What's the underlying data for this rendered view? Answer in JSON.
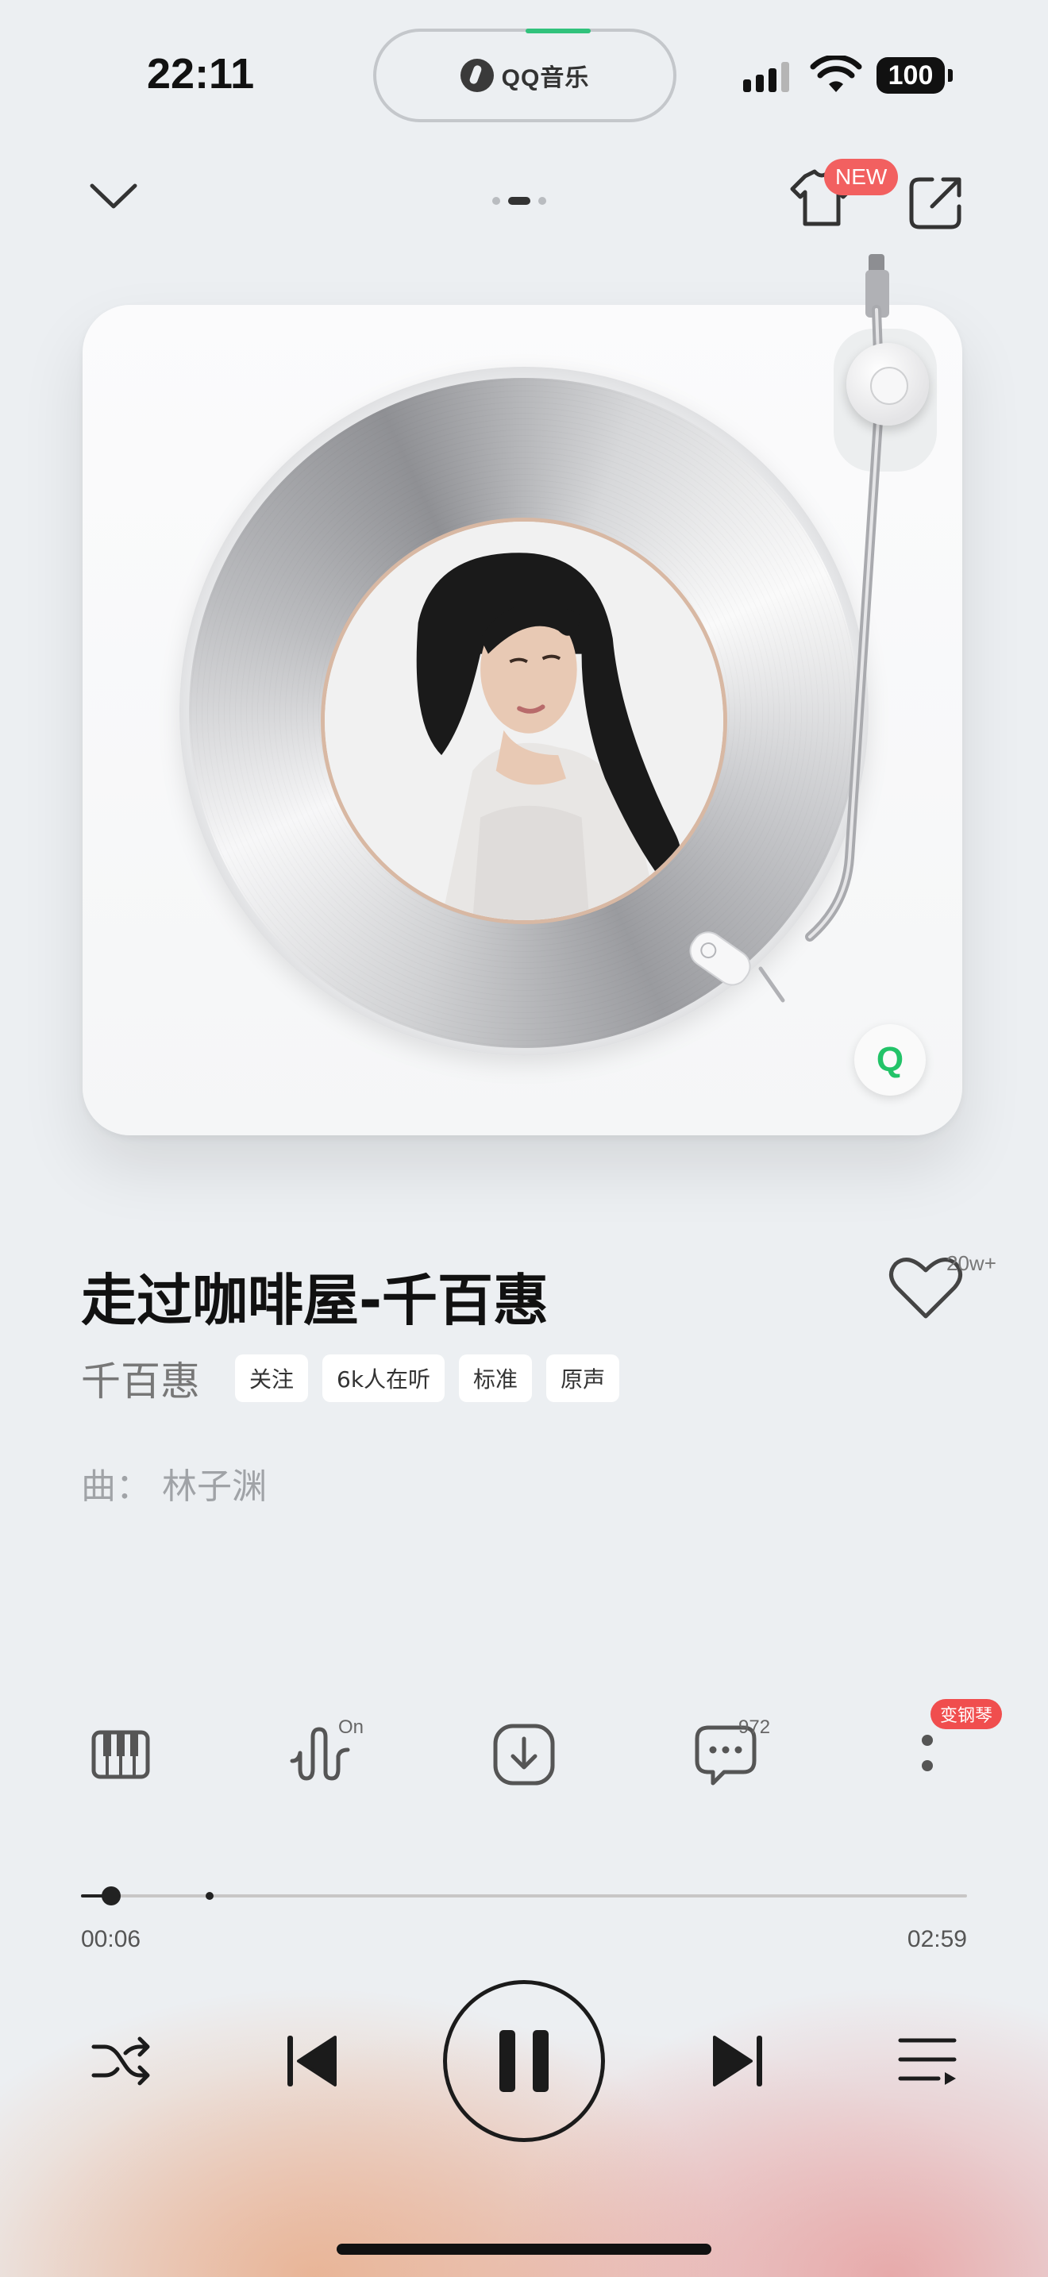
{
  "status_bar": {
    "time": "22:11",
    "island_app": "QQ音乐",
    "battery": "100",
    "colors": {
      "island_progress": "#31c27c"
    }
  },
  "top_nav": {
    "new_badge": "NEW",
    "page_indicator": {
      "count": 3,
      "active_index": 1
    },
    "icons": [
      "chevron-down-icon",
      "tshirt-icon",
      "share-icon"
    ]
  },
  "player_art": {
    "corner_logo": "Q",
    "colors": {
      "logo": "#22c368"
    }
  },
  "song": {
    "title": "走过咖啡屋-千百惠",
    "artist": "千百惠",
    "tags": [
      "关注",
      "6k人在听",
      "标准",
      "原声"
    ],
    "composer": "曲：  林子渊",
    "like_count": "20w+"
  },
  "actions": {
    "effect_on_label": "On",
    "comment_count": "972",
    "piano_badge": "变钢琴",
    "icons": [
      "piano-icon",
      "sound-effect-icon",
      "download-icon",
      "comment-icon",
      "more-icon"
    ]
  },
  "progress": {
    "elapsed": "00:06",
    "total": "02:59",
    "played_fraction": 0.034,
    "marker_fraction": 0.145
  },
  "controls": {
    "icons": [
      "shuffle-icon",
      "previous-icon",
      "pause-icon",
      "next-icon",
      "playlist-icon"
    ]
  }
}
